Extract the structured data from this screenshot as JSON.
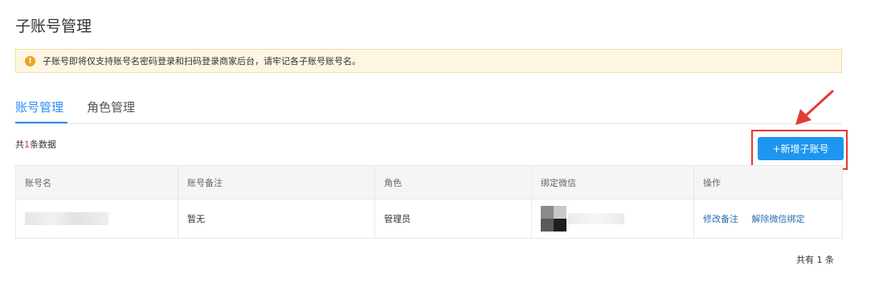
{
  "page": {
    "title": "子账号管理"
  },
  "notice": {
    "text": "子账号即将仅支持账号名密码登录和扫码登录商家后台，请牢记各子账号账号名。"
  },
  "tabs": [
    {
      "label": "账号管理",
      "active": true
    },
    {
      "label": "角色管理",
      "active": false
    }
  ],
  "summary": {
    "prefix": "共",
    "count": "1",
    "suffix": "条数据"
  },
  "toolbar": {
    "add_label": "+新增子账号"
  },
  "table": {
    "headers": [
      "账号名",
      "账号备注",
      "角色",
      "绑定微信",
      "操作"
    ],
    "rows": [
      {
        "remark": "暂无",
        "role": "管理员",
        "actions": [
          "修改备注",
          "解除微信绑定"
        ]
      }
    ]
  },
  "pagination": {
    "total_text": "共有 1 条"
  },
  "colors": {
    "accent": "#1d96f0",
    "link": "#2b6cb0",
    "highlight": "#e53935",
    "notice_bg": "#fdf6e2"
  }
}
